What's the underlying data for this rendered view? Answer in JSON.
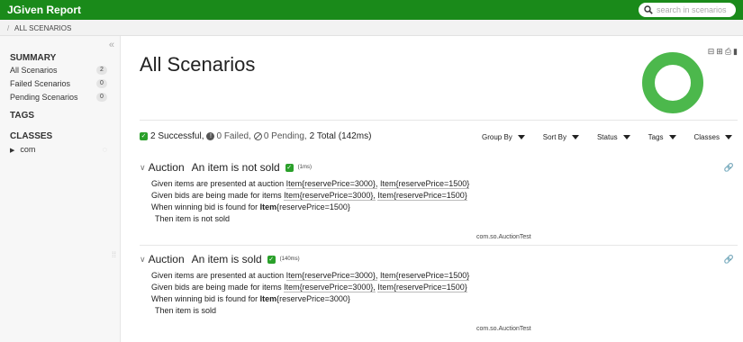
{
  "app": {
    "title": "JGiven Report"
  },
  "search": {
    "placeholder": "search in scenarios"
  },
  "breadcrumb": {
    "separator": "/",
    "current": "ALL SCENARIOS"
  },
  "sidebar": {
    "collapse_icon": "«",
    "summary_heading": "SUMMARY",
    "items": [
      {
        "label": "All Scenarios",
        "count": "2"
      },
      {
        "label": "Failed Scenarios",
        "count": "0"
      },
      {
        "label": "Pending Scenarios",
        "count": "0"
      }
    ],
    "tags_heading": "TAGS",
    "classes_heading": "CLASSES",
    "tree": [
      {
        "label": "com"
      }
    ]
  },
  "main": {
    "title": "All Scenarios",
    "summary": {
      "successful": "2 Successful,",
      "failed": "0 Failed,",
      "pending": "0 Pending,",
      "total": "2 Total (142ms)"
    },
    "filters": [
      "Group By",
      "Sort By",
      "Status",
      "Tags",
      "Classes"
    ],
    "colors": {
      "success": "#4cb84c",
      "topbar": "#1a8a1a"
    }
  },
  "chart_data": {
    "type": "pie",
    "categories": [
      "Successful",
      "Failed",
      "Pending"
    ],
    "values": [
      2,
      0,
      0
    ]
  },
  "scenarios": [
    {
      "class_label": "Auction",
      "name": "An item is not sold",
      "duration": "(1ms)",
      "steps": {
        "s1_kw": "Given items are presented at auction",
        "s1_a1": "Item{reservePrice=3000},",
        "s1_a2": "Item{reservePrice=1500}",
        "s2_kw": "Given bids are being made for items",
        "s2_a1": "Item{reservePrice=3000},",
        "s2_a2": "Item{reservePrice=1500}",
        "s3_kw": "When winning bid is found for",
        "s3_a1": "Item",
        "s3_a2": "{reservePrice=1500}",
        "s4": "Then item is not sold"
      },
      "classname": "com.so.AuctionTest"
    },
    {
      "class_label": "Auction",
      "name": "An item is sold",
      "duration": "(140ms)",
      "steps": {
        "s1_kw": "Given items are presented at auction",
        "s1_a1": "Item{reservePrice=3000},",
        "s1_a2": "Item{reservePrice=1500}",
        "s2_kw": "Given bids are being made for items",
        "s2_a1": "Item{reservePrice=3000},",
        "s2_a2": "Item{reservePrice=1500}",
        "s3_kw": "When winning bid is found for",
        "s3_a1": "Item",
        "s3_a2": "{reservePrice=3000}",
        "s4": "Then item is sold"
      },
      "classname": "com.so.AuctionTest"
    }
  ]
}
